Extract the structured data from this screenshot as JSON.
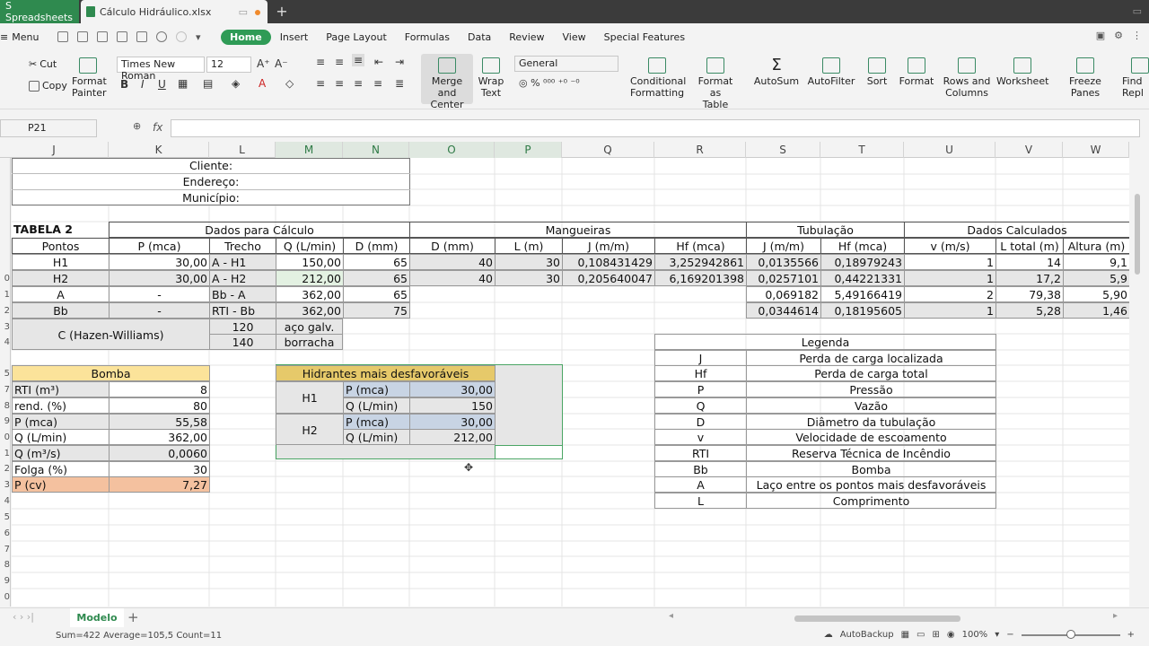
{
  "tabs": [
    {
      "label": "S Spreadsheets"
    },
    {
      "label": "Cálculo Hidráulico.xlsx"
    }
  ],
  "menu": {
    "main": "Menu",
    "tabs": [
      "Home",
      "Insert",
      "Page Layout",
      "Formulas",
      "Data",
      "Review",
      "View",
      "Special Features"
    ]
  },
  "ribbon": {
    "cut": "Cut",
    "copy": "Copy",
    "format_painter_1": "Format",
    "format_painter_2": "Painter",
    "font_name": "Times New Roman",
    "font_size": "12",
    "merge_1": "Merge and",
    "merge_2": "Center",
    "wrap_1": "Wrap",
    "wrap_2": "Text",
    "number_format": "General",
    "cond_1": "Conditional",
    "cond_2": "Formatting",
    "fmt_table_1": "Format as",
    "fmt_table_2": "Table",
    "autosum": "AutoSum",
    "autofilter": "AutoFilter",
    "sort": "Sort",
    "format": "Format",
    "rows_cols_1": "Rows and",
    "rows_cols_2": "Columns",
    "worksheet": "Worksheet",
    "freeze": "Freeze Panes",
    "find_1": "Find",
    "find_2": "Repl"
  },
  "formula_bar": {
    "cell_ref": "P21",
    "fx": "fx",
    "value": ""
  },
  "columns": [
    "J",
    "K",
    "L",
    "M",
    "N",
    "O",
    "P",
    "Q",
    "R",
    "S",
    "T",
    "U",
    "V",
    "W"
  ],
  "rows": [
    "",
    "",
    "",
    "",
    "",
    "0",
    "1",
    "2",
    "3",
    "4",
    "5",
    "7",
    "8",
    "9",
    "0",
    "1",
    "2",
    "3",
    "4",
    "5",
    "6",
    "7",
    "8",
    "9",
    "0",
    "1",
    "2",
    "3"
  ],
  "cells": {
    "cliente": "Cliente:",
    "endereco": "Endereço:",
    "municipio": "Município:",
    "tabela2": "TABELA 2",
    "dados_calculo": "Dados para Cálculo",
    "mangueiras": "Mangueiras",
    "tubulacao": "Tubulação",
    "dados_calculados": "Dados Calculados",
    "h_pontos": "Pontos",
    "h_p": "P (mca)",
    "h_trecho": "Trecho",
    "h_q": "Q (L/min)",
    "h_d": "D (mm)",
    "h_md": "D (mm)",
    "h_ml": "L (m)",
    "h_mj": "J (m/m)",
    "h_mhf": "Hf (mca)",
    "h_tj": "J (m/m)",
    "h_thf": "Hf (mca)",
    "h_v": "v (m/s)",
    "h_lt": "L total (m)",
    "h_alt": "Altura (m)",
    "rows": [
      [
        "H1",
        "30,00",
        "A - H1",
        "150,00",
        "65",
        "40",
        "30",
        "0,108431429",
        "3,252942861",
        "0,0135566",
        "0,18979243",
        "1",
        "14",
        "9,1"
      ],
      [
        "H2",
        "30,00",
        "A - H2",
        "212,00",
        "65",
        "40",
        "30",
        "0,205640047",
        "6,169201398",
        "0,0257101",
        "0,44221331",
        "1",
        "17,2",
        "5,9"
      ],
      [
        "A",
        "-",
        "Bb - A",
        "362,00",
        "65",
        "",
        "",
        "",
        "",
        "0,069182",
        "5,49166419",
        "2",
        "79,38",
        "5,90"
      ],
      [
        "Bb",
        "-",
        "RTI - Bb",
        "362,00",
        "75",
        "",
        "",
        "",
        "",
        "0,0344614",
        "0,18195605",
        "1",
        "5,28",
        "1,46"
      ]
    ],
    "hazen": "C (Hazen-Williams)",
    "c1": "120",
    "c1_label": "aço galv.",
    "c2": "140",
    "c2_label": "borracha",
    "bomba": "Bomba",
    "bomba_rows": [
      [
        "RTI (m³)",
        "8"
      ],
      [
        "rend. (%)",
        "80"
      ],
      [
        "P (mca)",
        "55,58"
      ],
      [
        "Q (L/min)",
        "362,00"
      ],
      [
        "Q (m³/s)",
        "0,0060"
      ],
      [
        "Folga (%)",
        "30"
      ],
      [
        "P (cv)",
        "7,27"
      ]
    ],
    "hidrantes": "Hidrantes mais desfavoráveis",
    "hid_h1": "H1",
    "hid_h2": "H2",
    "hid_rows": [
      [
        "P (mca)",
        "30,00"
      ],
      [
        "Q (L/min)",
        "150"
      ],
      [
        "P (mca)",
        "30,00"
      ],
      [
        "Q (L/min)",
        "212,00"
      ]
    ],
    "legenda": "Legenda",
    "legenda_rows": [
      [
        "J",
        "Perda de carga localizada"
      ],
      [
        "Hf",
        "Perda de carga total"
      ],
      [
        "P",
        "Pressão"
      ],
      [
        "Q",
        "Vazão"
      ],
      [
        "D",
        "Diâmetro da tubulação"
      ],
      [
        "v",
        "Velocidade de escoamento"
      ],
      [
        "RTI",
        "Reserva Técnica de Incêndio"
      ],
      [
        "Bb",
        "Bomba"
      ],
      [
        "A",
        "Laço entre os pontos mais desfavoráveis"
      ],
      [
        "L",
        "Comprimento"
      ]
    ]
  },
  "sheet_tab": "Modelo",
  "status": {
    "stats": "Sum=422  Average=105,5  Count=11",
    "autobackup": "AutoBackup",
    "zoom": "100%"
  },
  "colors": {
    "accent": "#2f9b56",
    "bomba_header": "#fbe39a",
    "pcv_row": "#f4c19f",
    "hid_header": "#e6c96a",
    "hid_cell": "#c8d4e4"
  }
}
